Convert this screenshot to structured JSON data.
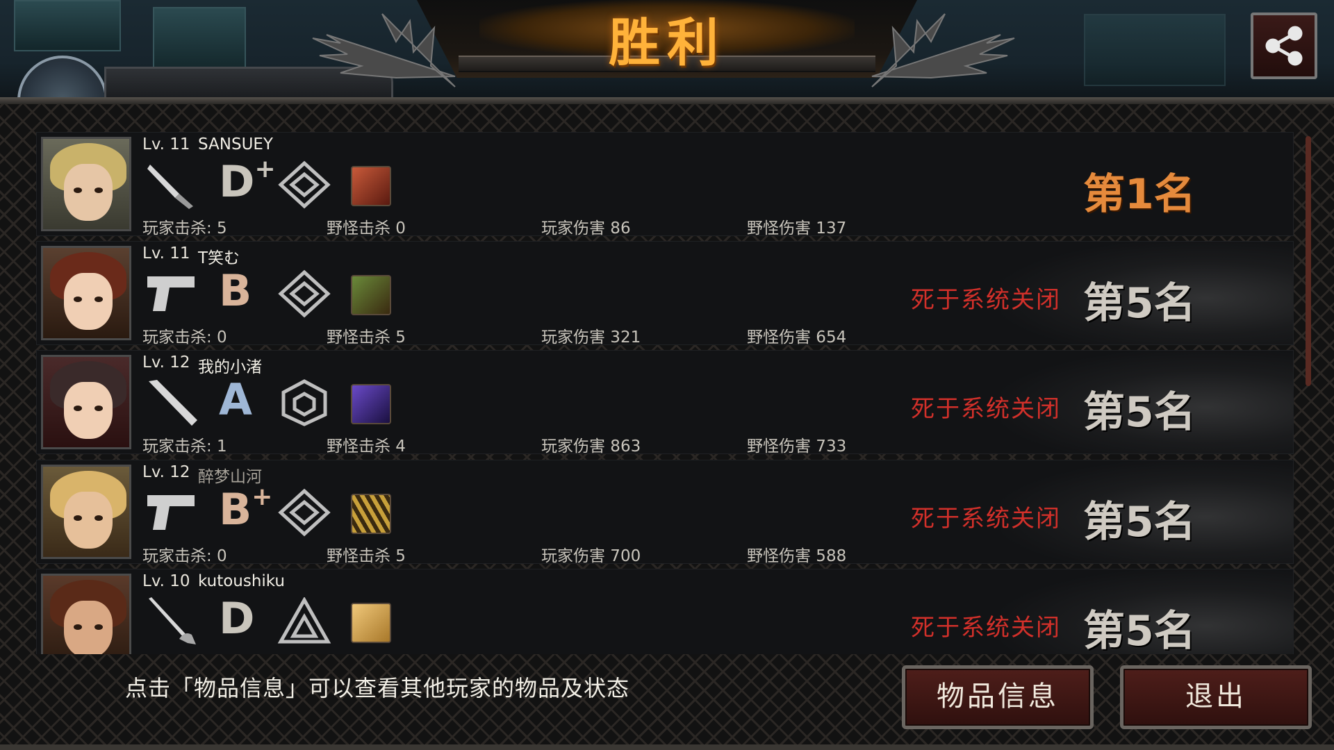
{
  "header": {
    "title": "胜利",
    "share_icon": "share-icon"
  },
  "players": [
    {
      "level": "Lv. 11",
      "name": "SANSUEY",
      "weapon_icon": "knife-icon",
      "grade": "D",
      "grade_sup": "+",
      "grade_color": "#c9c5bc",
      "rank_icon": "diamond-rank-icon",
      "player_kills": "玩家击杀: 5",
      "monster_kills": "野怪击杀 0",
      "player_damage": "玩家伤害 86",
      "monster_damage": "野怪伤害 137",
      "death_reason": "",
      "placement": "第1名"
    },
    {
      "level": "Lv. 11",
      "name": "T笑む",
      "weapon_icon": "pistol-icon",
      "grade": "B",
      "grade_sup": "",
      "grade_color": "#d9b49a",
      "rank_icon": "diamond-rank-icon",
      "player_kills": "玩家击杀: 0",
      "monster_kills": "野怪击杀 5",
      "player_damage": "玩家伤害 321",
      "monster_damage": "野怪伤害 654",
      "death_reason": "死于系统关闭",
      "placement": "第5名"
    },
    {
      "level": "Lv. 12",
      "name": "我的小渚",
      "weapon_icon": "bat-icon",
      "grade": "A",
      "grade_sup": "",
      "grade_color": "#9fb7d6",
      "rank_icon": "hexagon-rank-icon",
      "player_kills": "玩家击杀: 1",
      "monster_kills": "野怪击杀 4",
      "player_damage": "玩家伤害 863",
      "monster_damage": "野怪伤害 733",
      "death_reason": "死于系统关闭",
      "placement": "第5名"
    },
    {
      "level": "Lv. 12",
      "name": "醉梦山河",
      "weapon_icon": "pistol-icon",
      "grade": "B",
      "grade_sup": "+",
      "grade_color": "#d9b49a",
      "rank_icon": "diamond-rank-icon",
      "player_kills": "玩家击杀: 0",
      "monster_kills": "野怪击杀 5",
      "player_damage": "玩家伤害 700",
      "monster_damage": "野怪伤害 588",
      "death_reason": "死于系统关闭",
      "placement": "第5名"
    },
    {
      "level": "Lv. 10",
      "name": "kutoushiku",
      "weapon_icon": "rapier-icon",
      "grade": "D",
      "grade_sup": "",
      "grade_color": "#c9c5bc",
      "rank_icon": "triangle-rank-icon",
      "player_kills": "",
      "monster_kills": "",
      "player_damage": "",
      "monster_damage": "",
      "death_reason": "死于系统关闭",
      "placement": "第5名"
    }
  ],
  "footer": {
    "hint": "点击「物品信息」可以查看其他玩家的物品及状态",
    "item_info_button": "物品信息",
    "exit_button": "退出"
  }
}
